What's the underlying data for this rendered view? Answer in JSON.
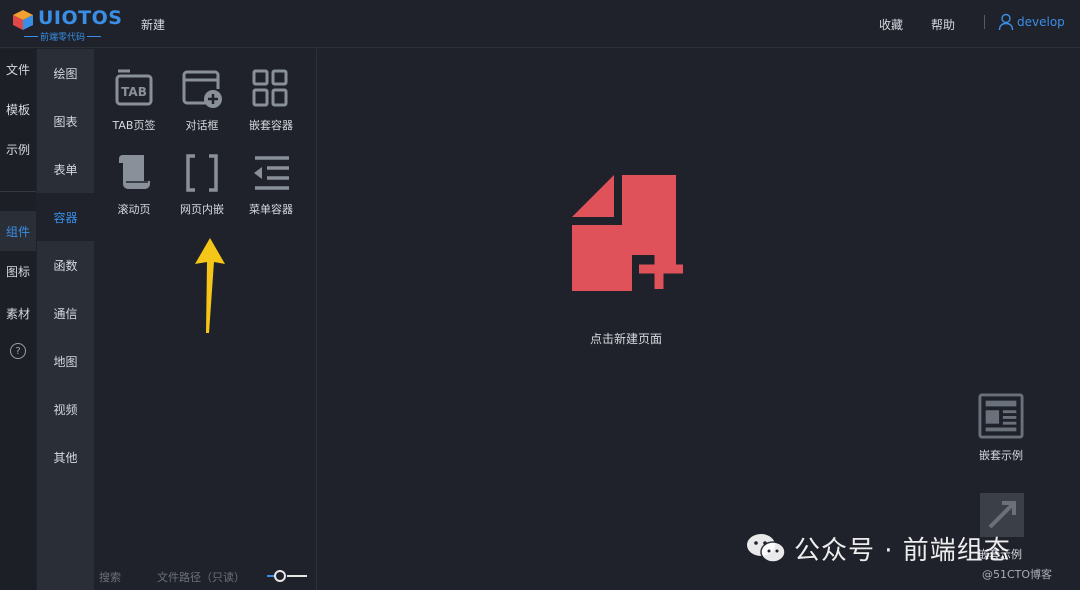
{
  "header": {
    "logo_text": "UIOTOS",
    "logo_sub": "前端零代码",
    "new_label": "新建",
    "favorite_label": "收藏",
    "help_label": "帮助",
    "separator": "|",
    "username": "develop"
  },
  "nav_primary": {
    "items": [
      {
        "label": "文件"
      },
      {
        "label": "模板"
      },
      {
        "label": "示例"
      },
      {
        "label": "组件"
      },
      {
        "label": "图标"
      },
      {
        "label": "素材"
      }
    ],
    "help_glyph": "?"
  },
  "nav_secondary": {
    "items": [
      {
        "label": "绘图"
      },
      {
        "label": "图表"
      },
      {
        "label": "表单"
      },
      {
        "label": "容器"
      },
      {
        "label": "函数"
      },
      {
        "label": "通信"
      },
      {
        "label": "地图"
      },
      {
        "label": "视频"
      },
      {
        "label": "其他"
      }
    ]
  },
  "components": [
    {
      "label": "TAB页签",
      "icon": "tab-icon",
      "icon_text": "TAB"
    },
    {
      "label": "对话框",
      "icon": "dialog-add-icon"
    },
    {
      "label": "嵌套容器",
      "icon": "grid-layout-icon"
    },
    {
      "label": "滚动页",
      "icon": "scroll-icon"
    },
    {
      "label": "网页内嵌",
      "icon": "brackets-icon"
    },
    {
      "label": "菜单容器",
      "icon": "menu-list-icon"
    }
  ],
  "panel_footer": {
    "search_label": "搜索",
    "path_label": "文件路径（只读）"
  },
  "main": {
    "new_page_label": "点击新建页面",
    "nested_example_label": "嵌套示例",
    "second_example_label": "嵌套示例"
  },
  "watermark": {
    "text": "公众号 · 前端组态",
    "site": "@51CTO博客"
  },
  "colors": {
    "accent": "#3a8ee6",
    "new_page_red": "#e0525a",
    "arrow_yellow": "#f5c518"
  }
}
